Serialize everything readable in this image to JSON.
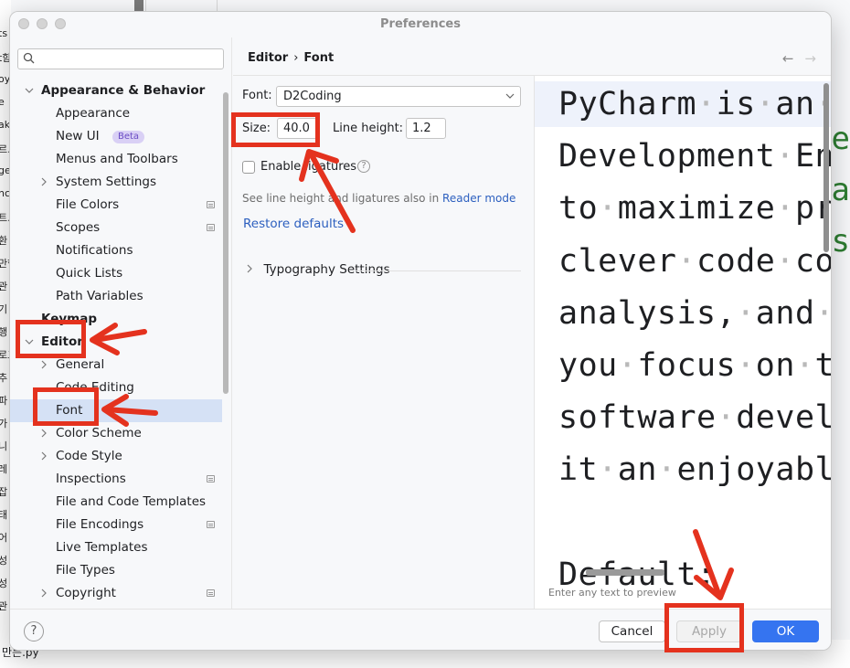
{
  "background": {
    "left_snippets": [
      "ts",
      "t함",
      "oy",
      "e",
      "ak",
      "르.p",
      "ge",
      "nc",
      "트.",
      "환",
      "만함",
      "관",
      "기",
      "행",
      "로그",
      "추",
      "파",
      "가",
      "니",
      "레",
      "잡",
      "태",
      "어",
      "성",
      "성",
      "관"
    ],
    "bottom_file": "만든.py"
  },
  "window": {
    "title": "Preferences"
  },
  "sidebar": {
    "search_placeholder": "",
    "items": [
      {
        "label": "Appearance & Behavior",
        "level": 0,
        "expanded": true,
        "bold": true
      },
      {
        "label": "Appearance",
        "level": 1
      },
      {
        "label": "New UI",
        "level": 1,
        "badge": "Beta"
      },
      {
        "label": "Menus and Toolbars",
        "level": 1
      },
      {
        "label": "System Settings",
        "level": 1,
        "collapsible": true
      },
      {
        "label": "File Colors",
        "level": 1,
        "project": true
      },
      {
        "label": "Scopes",
        "level": 1,
        "project": true
      },
      {
        "label": "Notifications",
        "level": 1
      },
      {
        "label": "Quick Lists",
        "level": 1
      },
      {
        "label": "Path Variables",
        "level": 1
      },
      {
        "label": "Keymap",
        "level": 0,
        "bold": true
      },
      {
        "label": "Editor",
        "level": 0,
        "expanded": true,
        "bold": true
      },
      {
        "label": "General",
        "level": 1,
        "collapsible": true
      },
      {
        "label": "Code Editing",
        "level": 1
      },
      {
        "label": "Font",
        "level": 1,
        "selected": true
      },
      {
        "label": "Color Scheme",
        "level": 1,
        "collapsible": true
      },
      {
        "label": "Code Style",
        "level": 1,
        "collapsible": true
      },
      {
        "label": "Inspections",
        "level": 1,
        "project": true
      },
      {
        "label": "File and Code Templates",
        "level": 1
      },
      {
        "label": "File Encodings",
        "level": 1,
        "project": true
      },
      {
        "label": "Live Templates",
        "level": 1
      },
      {
        "label": "File Types",
        "level": 1
      },
      {
        "label": "Copyright",
        "level": 1,
        "collapsible": true,
        "project": true
      }
    ]
  },
  "breadcrumb": {
    "parent": "Editor",
    "separator": "›",
    "current": "Font",
    "back": "←",
    "forward": "→"
  },
  "font_settings": {
    "font_label": "Font:",
    "font_value": "D2Coding",
    "size_label": "Size:",
    "size_value": "40.0",
    "line_height_label": "Line height:",
    "line_height_value": "1.2",
    "ligatures_label": "Enable ligatures",
    "ligatures_checked": false,
    "hint_text": "See line height and ligatures also in ",
    "hint_link": "Reader mode",
    "restore_defaults": "Restore defaults",
    "typography_label": "Typography Settings"
  },
  "preview": {
    "lines": [
      "PyCharm·is·an·I",
      "Development·Env",
      "to·maximize·pro",
      "clever·code·com",
      "analysis,·and·r",
      "you·focus·on·th",
      "software·develo",
      "it·an·enjoyable",
      "",
      "Default:"
    ],
    "footer_text": "Enter any text to preview"
  },
  "footer": {
    "help": "?",
    "cancel": "Cancel",
    "apply": "Apply",
    "ok": "OK"
  },
  "colors": {
    "accent": "#3574f0",
    "selection": "#d5e1f5",
    "annotation_red": "#e4321e"
  }
}
